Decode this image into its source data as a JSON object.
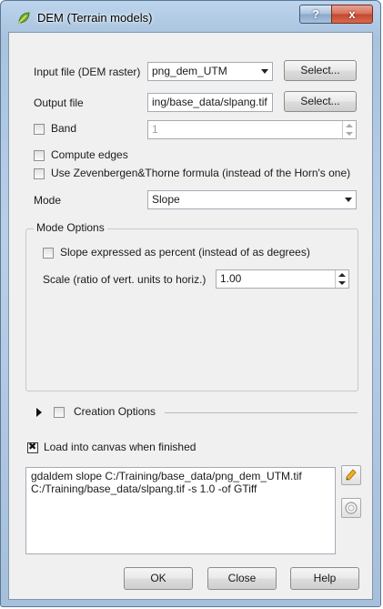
{
  "window": {
    "title": "DEM (Terrain models)",
    "help_label": "?",
    "close_label": "x"
  },
  "form": {
    "input_label": "Input file (DEM raster)",
    "input_value": "png_dem_UTM",
    "input_select": "Select...",
    "output_label": "Output file",
    "output_value": "ing/base_data/slpang.tif",
    "output_select": "Select...",
    "band_label": "Band",
    "band_value": "1",
    "compute_edges_label": "Compute edges",
    "zevenbergen_label": "Use Zevenbergen&Thorne formula (instead of the Horn's one)",
    "mode_label": "Mode",
    "mode_value": "Slope"
  },
  "mode_options": {
    "title": "Mode Options",
    "percent_label": "Slope expressed as percent (instead of as degrees)",
    "scale_label": "Scale (ratio of vert. units to horiz.)",
    "scale_value": "1.00"
  },
  "creation_options": {
    "label": "Creation Options"
  },
  "load_canvas": {
    "label": "Load into canvas when finished",
    "checked": true
  },
  "command": {
    "text": "gdaldem slope C:/Training/base_data/png_dem_UTM.tif\nC:/Training/base_data/slpang.tif -s 1.0 -of GTiff"
  },
  "buttons": {
    "ok": "OK",
    "close": "Close",
    "help": "Help"
  },
  "icons": {
    "app": "qgis-leaf-icon",
    "edit": "pencil-icon",
    "reset": "reset-circle-icon"
  }
}
